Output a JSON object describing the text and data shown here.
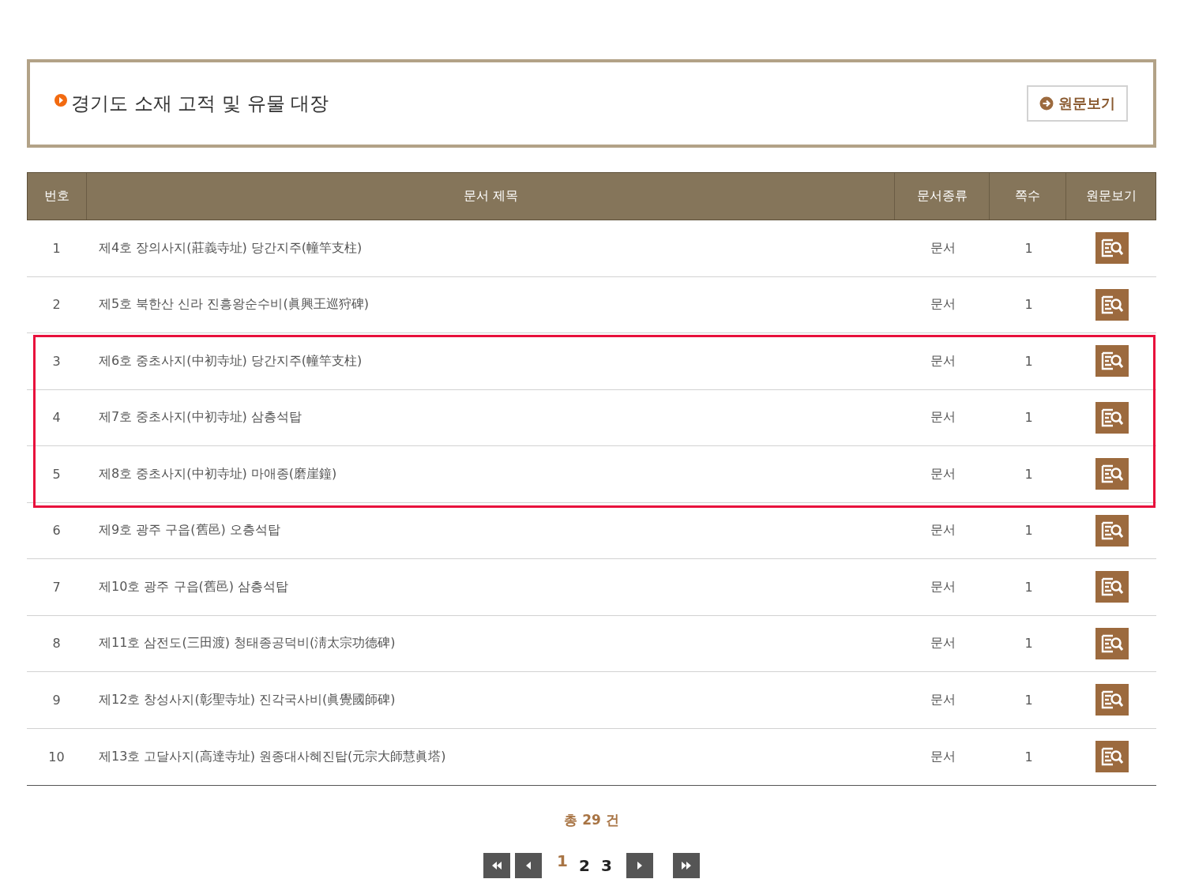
{
  "title": "경기도 소재 고적 및 유물 대장",
  "view_button": "원문보기",
  "table": {
    "columns": [
      "번호",
      "문서 제목",
      "문서종류",
      "쪽수",
      "원문보기"
    ],
    "rows": [
      {
        "no": "1",
        "title": "제4호 장의사지(莊義寺址) 당간지주(幢竿支柱)",
        "type": "문서",
        "pages": "1",
        "highlighted": false
      },
      {
        "no": "2",
        "title": "제5호 북한산 신라 진흥왕순수비(眞興王巡狩碑)",
        "type": "문서",
        "pages": "1",
        "highlighted": false
      },
      {
        "no": "3",
        "title": "제6호 중초사지(中初寺址) 당간지주(幢竿支柱)",
        "type": "문서",
        "pages": "1",
        "highlighted": true
      },
      {
        "no": "4",
        "title": "제7호 중초사지(中初寺址) 삼층석탑",
        "type": "문서",
        "pages": "1",
        "highlighted": true
      },
      {
        "no": "5",
        "title": "제8호 중초사지(中初寺址) 마애종(磨崖鐘)",
        "type": "문서",
        "pages": "1",
        "highlighted": true
      },
      {
        "no": "6",
        "title": "제9호 광주 구읍(舊邑) 오층석탑",
        "type": "문서",
        "pages": "1",
        "highlighted": false
      },
      {
        "no": "7",
        "title": "제10호 광주 구읍(舊邑) 삼층석탑",
        "type": "문서",
        "pages": "1",
        "highlighted": false
      },
      {
        "no": "8",
        "title": "제11호 삼전도(三田渡) 청태종공덕비(淸太宗功德碑)",
        "type": "문서",
        "pages": "1",
        "highlighted": false
      },
      {
        "no": "9",
        "title": "제12호 창성사지(彰聖寺址) 진각국사비(眞覺國師碑)",
        "type": "문서",
        "pages": "1",
        "highlighted": false
      },
      {
        "no": "10",
        "title": "제13호 고달사지(高達寺址) 원종대사혜진탑(元宗大師慧眞塔)",
        "type": "문서",
        "pages": "1",
        "highlighted": false
      }
    ]
  },
  "total": "총 29 건",
  "pages": [
    {
      "label": "1",
      "selected": true
    },
    {
      "label": "2",
      "selected": false
    },
    {
      "label": "3",
      "selected": false
    }
  ]
}
